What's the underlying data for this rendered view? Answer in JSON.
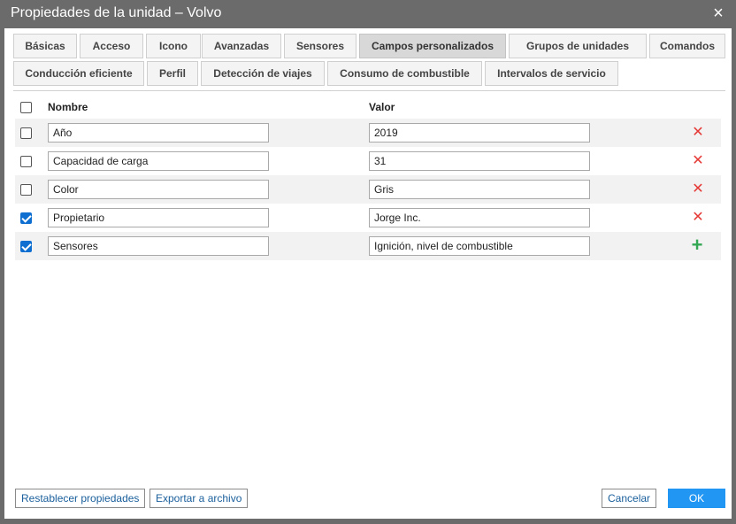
{
  "window": {
    "title": "Propiedades de la unidad – Volvo",
    "close_icon": "×"
  },
  "tabs": {
    "row1": [
      "Básicas",
      "Acceso",
      "Icono",
      "Avanzadas",
      "Sensores",
      "Campos personalizados",
      "Grupos de unidades",
      "Comandos"
    ],
    "row2": [
      "Conducción eficiente",
      "Perfil",
      "Detección de viajes",
      "Consumo de combustible",
      "Intervalos de servicio"
    ],
    "active": "Campos personalizados"
  },
  "table": {
    "headers": {
      "name": "Nombre",
      "value": "Valor"
    },
    "rows": [
      {
        "checked": false,
        "name": "Año",
        "value": "2019",
        "action": "delete-icon"
      },
      {
        "checked": false,
        "name": "Capacidad de carga",
        "value": "31",
        "action": "delete-icon"
      },
      {
        "checked": false,
        "name": "Color",
        "value": "Gris",
        "action": "delete-icon"
      },
      {
        "checked": true,
        "name": "Propietario",
        "value": "Jorge Inc.",
        "action": "delete-icon"
      },
      {
        "checked": true,
        "name": "Sensores",
        "value": "Ignición, nivel de combustible",
        "action": "plus-icon"
      }
    ],
    "delete_glyph": "✕",
    "add_glyph": "+"
  },
  "footer": {
    "reset_label": "Restablecer propiedades",
    "export_label": "Exportar a archivo",
    "cancel_label": "Cancelar",
    "ok_label": "OK"
  },
  "colors": {
    "titlebar": "#6b6b6b",
    "accent": "#2196f3",
    "delete": "#e53935",
    "add": "#33a853",
    "checkbox": "#0f6fd1"
  }
}
